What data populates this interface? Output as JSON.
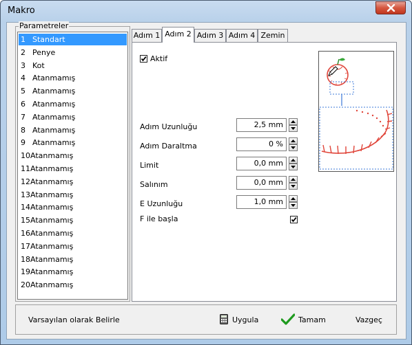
{
  "window": {
    "title": "Makro"
  },
  "parameters": {
    "group_label": "Parametreler",
    "items": [
      {
        "num": "1",
        "label": "Standart",
        "selected": true
      },
      {
        "num": "2",
        "label": "Penye"
      },
      {
        "num": "3",
        "label": "Kot"
      },
      {
        "num": "4",
        "label": "Atanmamış"
      },
      {
        "num": "5",
        "label": "Atanmamış"
      },
      {
        "num": "6",
        "label": "Atanmamış"
      },
      {
        "num": "7",
        "label": "Atanmamış"
      },
      {
        "num": "8",
        "label": "Atanmamış"
      },
      {
        "num": "9",
        "label": "Atanmamış"
      },
      {
        "num": "10",
        "label": "Atanmamış"
      },
      {
        "num": "11",
        "label": "Atanmamış"
      },
      {
        "num": "12",
        "label": "Atanmamış"
      },
      {
        "num": "13",
        "label": "Atanmamış"
      },
      {
        "num": "14",
        "label": "Atanmamış"
      },
      {
        "num": "15",
        "label": "Atanmamış"
      },
      {
        "num": "16",
        "label": "Atanmamış"
      },
      {
        "num": "17",
        "label": "Atanmamış"
      },
      {
        "num": "18",
        "label": "Atanmamış"
      },
      {
        "num": "19",
        "label": "Atanmamış"
      },
      {
        "num": "20",
        "label": "Atanmamış"
      }
    ]
  },
  "tabs": [
    {
      "label": "Adım 1"
    },
    {
      "label": "Adım 2",
      "active": true
    },
    {
      "label": "Adım 3"
    },
    {
      "label": "Adım 4"
    },
    {
      "label": "Zemin"
    }
  ],
  "panel": {
    "aktif_label": "Aktif",
    "aktif_checked": true,
    "fields": [
      {
        "label": "Adım Uzunluğu",
        "value": "2,5 mm"
      },
      {
        "label": "Adım Daraltma",
        "value": "0 %"
      },
      {
        "label": "Limit",
        "value": "0,0 mm"
      },
      {
        "label": "Salınım",
        "value": "0,0 mm"
      },
      {
        "label": "E Uzunluğu",
        "value": "1,0 mm"
      }
    ],
    "f_ile_basla_label": "F ile başla",
    "f_ile_basla_checked": true
  },
  "buttons": {
    "default_label": "Varsayılan olarak Belirle",
    "apply_label": "Uygula",
    "ok_label": "Tamam",
    "cancel_label": "Vazgeç"
  },
  "colors": {
    "selection": "#3399ff",
    "close_button": "#d5573f",
    "stitch_red": "#e0453a",
    "guide_blue": "#3b78d8"
  }
}
